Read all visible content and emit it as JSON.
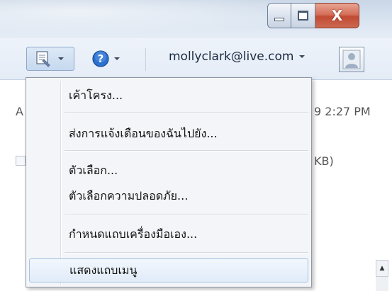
{
  "window": {
    "minimize_symbol": "—",
    "maximize_symbol": "□",
    "close_symbol": "X"
  },
  "toolbar": {
    "account": "mollyclark@live.com"
  },
  "background": {
    "left_edge_text": "A",
    "time_fragment": "9 2:27 PM",
    "size_fragment": "KB)"
  },
  "menu": {
    "items": [
      {
        "label": "เค้าโครง..."
      },
      {
        "label": "ส่งการแจ้งเตือนของฉันไปยัง..."
      },
      {
        "label": "ตัวเลือก..."
      },
      {
        "label": "ตัวเลือกความปลอดภัย..."
      },
      {
        "label": "กำหนดแถบเครื่องมือเอง..."
      },
      {
        "label": "แสดงแถบเมนู"
      }
    ]
  },
  "icons": {
    "tools": "tools-menu-icon",
    "help": "help-icon",
    "avatar": "user-avatar-icon"
  },
  "colors": {
    "close_button": "#c24a33",
    "help_blue": "#1f5fbf",
    "menu_highlight_border": "#a8c1e0"
  }
}
